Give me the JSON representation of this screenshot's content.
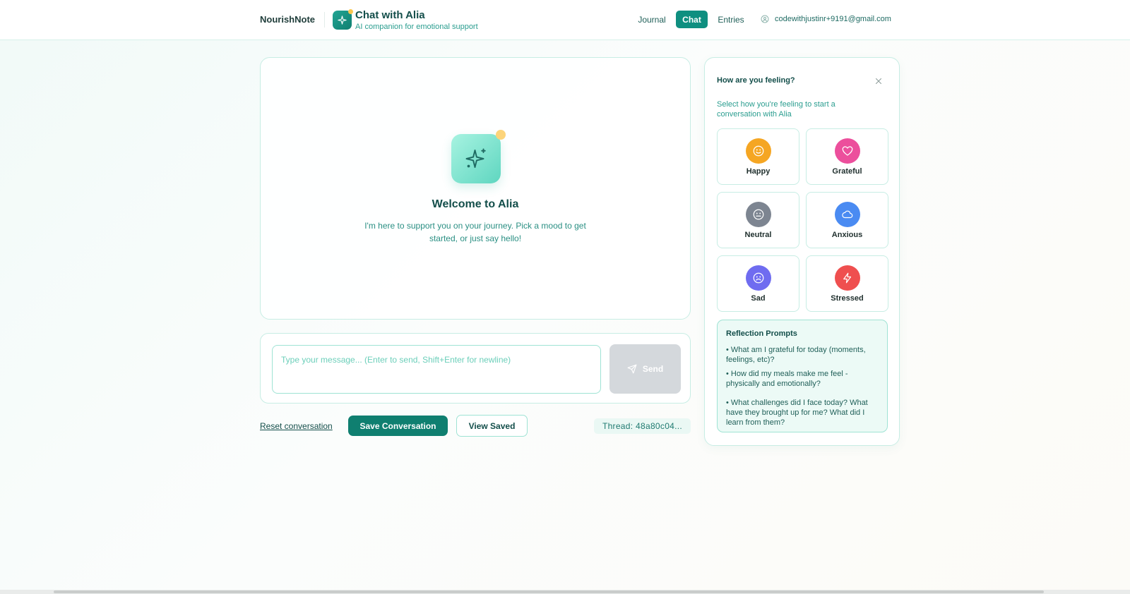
{
  "header": {
    "brand": "NourishNote",
    "title": "Chat with Alia",
    "subtitle": "AI companion for emotional support",
    "nav": {
      "journal": "Journal",
      "chat": "Chat",
      "entries": "Entries"
    },
    "user_email": "codewithjustinr+9191@gmail.com"
  },
  "chat": {
    "welcome_title": "Welcome to Alia",
    "welcome_text": "I'm here to support you on your journey. Pick a mood to get started, or just say hello!"
  },
  "composer": {
    "placeholder": "Type your message... (Enter to send, Shift+Enter for newline)",
    "value": "",
    "send_label": "Send"
  },
  "actions": {
    "reset_label": "Reset conversation",
    "save_label": "Save Conversation",
    "view_saved_label": "View Saved",
    "thread": "Thread: 48a80c04..."
  },
  "mood_panel": {
    "title": "How are you feeling?",
    "description": "Select how you're feeling to start a conversation with Alia",
    "moods": [
      {
        "label": "Happy",
        "icon": "smile-icon",
        "color": "#f5a623"
      },
      {
        "label": "Grateful",
        "icon": "heart-icon",
        "color": "#ec4f9c"
      },
      {
        "label": "Neutral",
        "icon": "neutral-face-icon",
        "color": "#7d8591"
      },
      {
        "label": "Anxious",
        "icon": "cloud-icon",
        "color": "#4a8bf2"
      },
      {
        "label": "Sad",
        "icon": "frown-icon",
        "color": "#6f6cf0"
      },
      {
        "label": "Stressed",
        "icon": "lightning-icon",
        "color": "#ef4f4f"
      }
    ],
    "prompts_title": "Reflection Prompts",
    "prompts": [
      "• What am I grateful for today (moments, feelings, etc)?",
      "• How did my meals make me feel - physically and emotionally?",
      "• What challenges did I face today? What have they brought up for me? What did I learn from them?"
    ]
  },
  "colors": {
    "accent": "#0f8f80",
    "accent_dark": "#0f7f70",
    "border": "#c7ede4",
    "send_disabled": "#d4d8dc"
  }
}
